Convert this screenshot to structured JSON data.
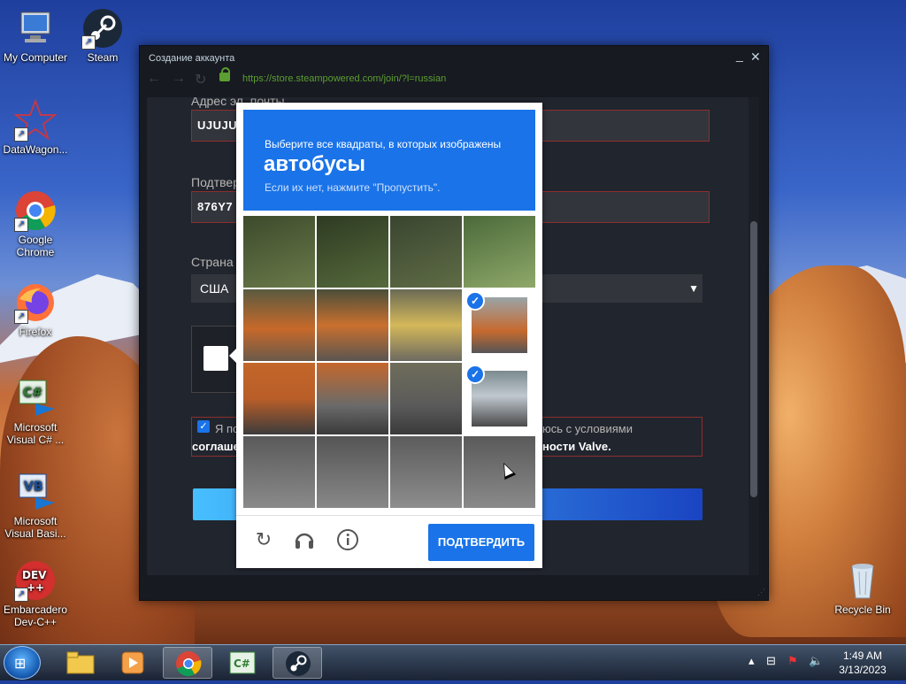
{
  "desktop": {
    "icons": [
      {
        "label": "My Computer"
      },
      {
        "label": "Steam"
      },
      {
        "label": "DataWagon..."
      },
      {
        "label": "Google Chrome"
      },
      {
        "label": "Firefox"
      },
      {
        "label": "Microsoft Visual C# ..."
      },
      {
        "label": "Microsoft Visual Basi..."
      },
      {
        "label": "Embarcadero Dev-C++"
      },
      {
        "label": "Recycle Bin"
      }
    ]
  },
  "window": {
    "title": "Создание аккаунта",
    "minimize_glyph": "_",
    "close_glyph": "✕",
    "url": "https://store.steampowered.com/join/?l=russian"
  },
  "form": {
    "email_label": "Адрес эл. почты",
    "email_value": "UJUJU",
    "confirm_label": "Подтвер",
    "confirm_value": "876Y7",
    "country_label": "Страна",
    "country_value": "США",
    "agree_text_start": "Я по",
    "agree_text_end": "юсь с условиями",
    "agree_line2_start": "соглаше",
    "agree_line2_end": "ности Valve."
  },
  "captcha": {
    "line1": "Выберите все квадраты, в которых изображены",
    "word": "автобусы",
    "line3": "Если их нет, нажмите \"Пропустить\".",
    "verify_label": "ПОДТВЕРДИТЬ",
    "selected_tiles": [
      7,
      11
    ]
  },
  "taskbar": {
    "time": "1:49 AM",
    "date": "3/13/2023"
  }
}
